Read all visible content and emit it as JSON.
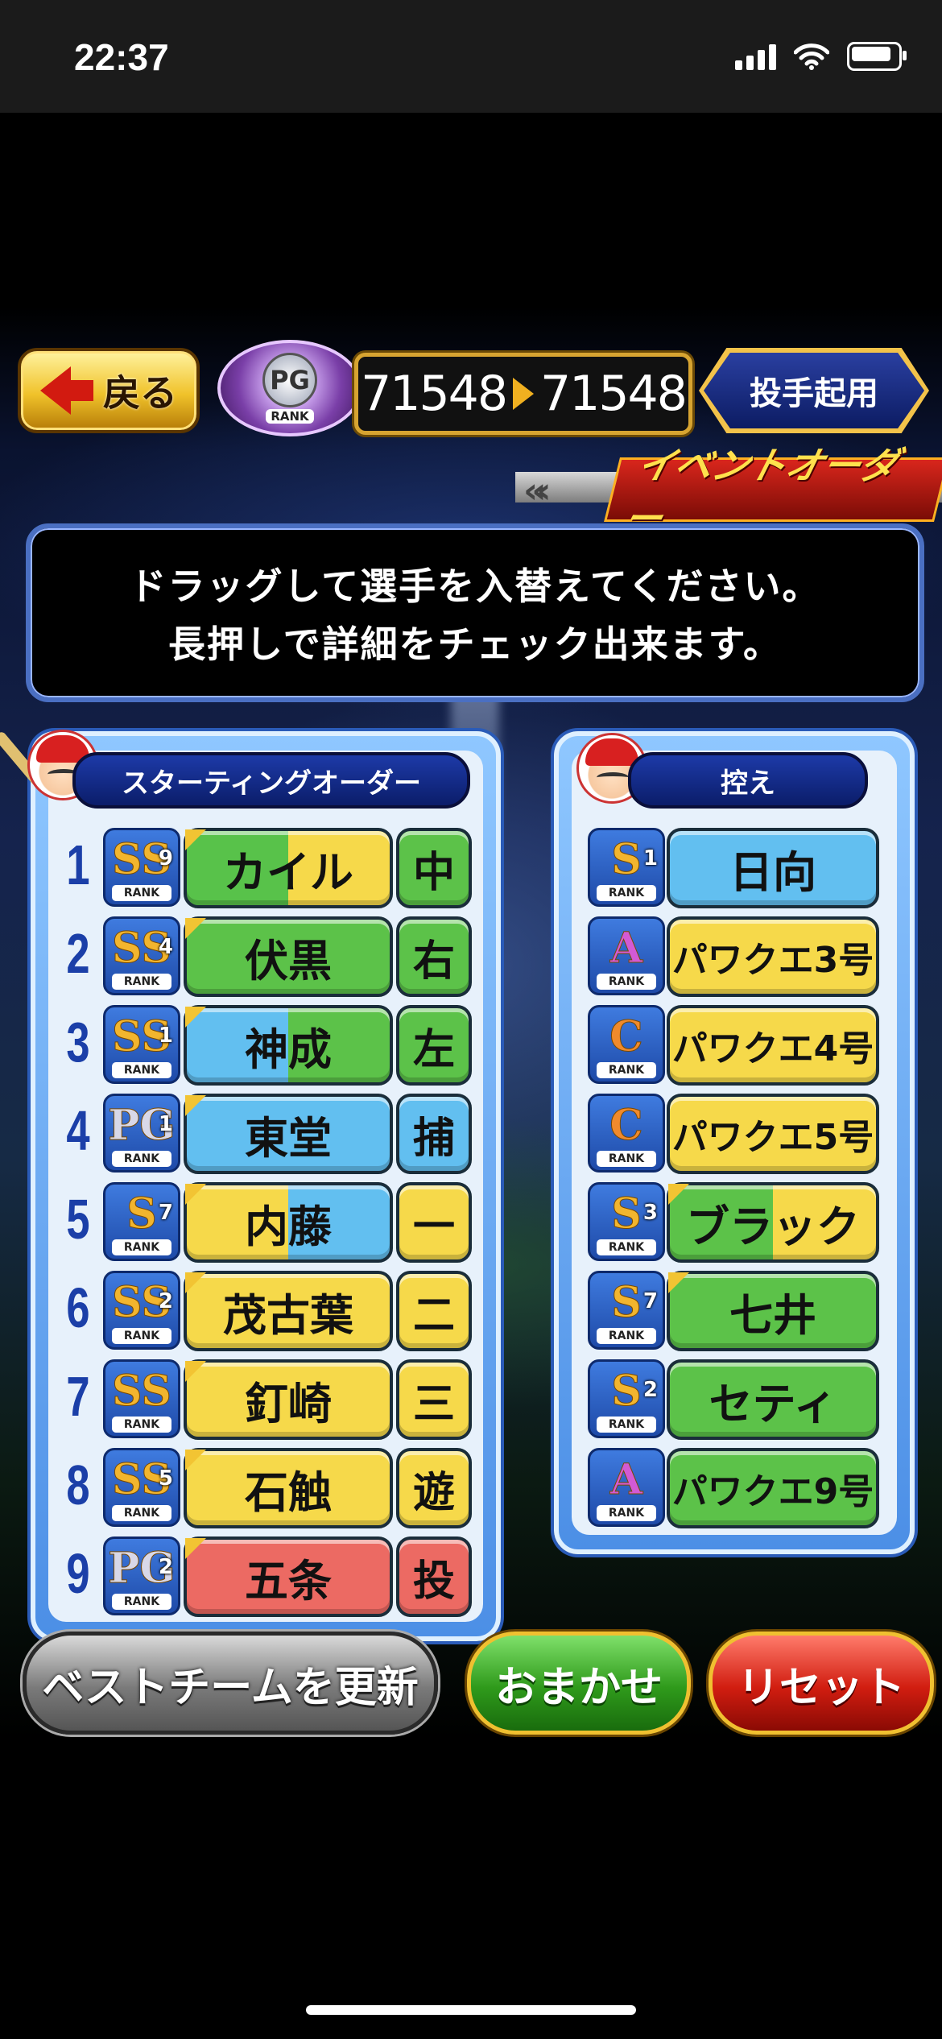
{
  "status_bar": {
    "time": "22:37"
  },
  "header": {
    "back_label": "戻る",
    "score_current": "71548",
    "score_next": "71548",
    "pitcher_button_label": "投手起用",
    "rank_emblem": {
      "letters": "PG",
      "rank_text": "RANK"
    },
    "event_banner": "イベントオーダー"
  },
  "instructions": {
    "line1": "ドラッグして選手を入替えてください。",
    "line2": "長押しで詳細をチェック出来ます。"
  },
  "starting_order": {
    "title": "スターティングオーダー",
    "players": [
      {
        "num": "1",
        "rank": "SS",
        "rank_level": "9",
        "name": "カイル",
        "position": "中"
      },
      {
        "num": "2",
        "rank": "SS",
        "rank_level": "4",
        "name": "伏黒",
        "position": "右"
      },
      {
        "num": "3",
        "rank": "SS",
        "rank_level": "1",
        "name": "神成",
        "position": "左"
      },
      {
        "num": "4",
        "rank": "PG",
        "rank_level": "1",
        "name": "東堂",
        "position": "捕"
      },
      {
        "num": "5",
        "rank": "S",
        "rank_level": "7",
        "name": "内藤",
        "position": "一"
      },
      {
        "num": "6",
        "rank": "SS",
        "rank_level": "2",
        "name": "茂古葉",
        "position": "二"
      },
      {
        "num": "7",
        "rank": "SS",
        "rank_level": "",
        "name": "釘崎",
        "position": "三"
      },
      {
        "num": "8",
        "rank": "SS",
        "rank_level": "5",
        "name": "石触",
        "position": "遊"
      },
      {
        "num": "9",
        "rank": "PG",
        "rank_level": "2",
        "name": "五条",
        "position": "投"
      }
    ]
  },
  "bench": {
    "title": "控え",
    "players": [
      {
        "rank": "S",
        "rank_level": "1",
        "name": "日向"
      },
      {
        "rank": "A",
        "rank_level": "",
        "name": "パワクエ3号"
      },
      {
        "rank": "C",
        "rank_level": "",
        "name": "パワクエ4号"
      },
      {
        "rank": "C",
        "rank_level": "",
        "name": "パワクエ5号"
      },
      {
        "rank": "S",
        "rank_level": "3",
        "name": "ブラック"
      },
      {
        "rank": "S",
        "rank_level": "7",
        "name": "七井"
      },
      {
        "rank": "S",
        "rank_level": "2",
        "name": "セティ"
      },
      {
        "rank": "A",
        "rank_level": "",
        "name": "パワクエ9号"
      }
    ]
  },
  "rank_label": "RANK",
  "buttons": {
    "best_team": "ベストチームを更新",
    "omakase": "おまかせ",
    "reset": "リセット"
  },
  "colors": {
    "green": "#3fb53a",
    "yellow": "#f4d23c",
    "blue": "#58b8ef",
    "red": "#e8605c",
    "accent_gold": "#d7a431"
  }
}
